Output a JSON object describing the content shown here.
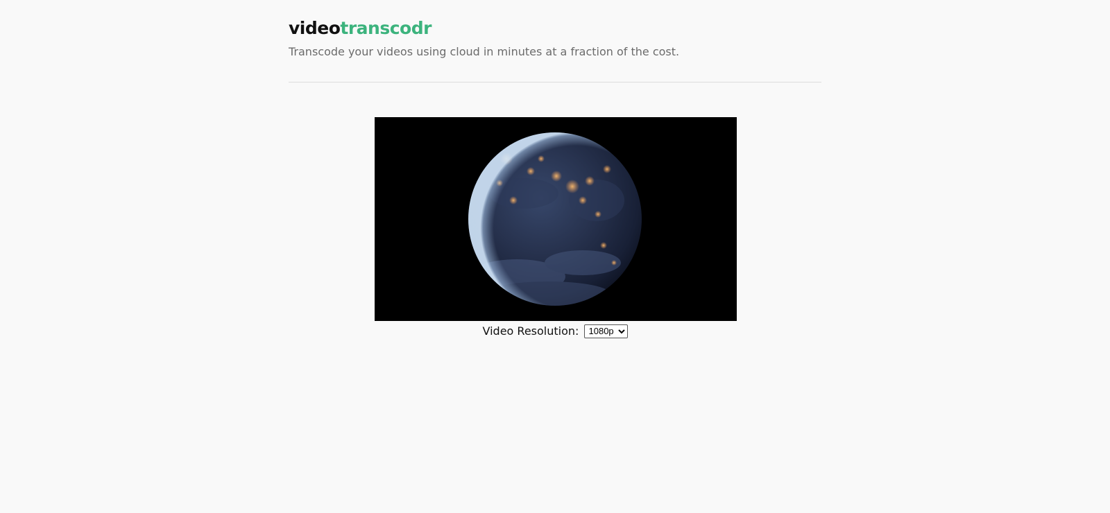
{
  "header": {
    "brand_part1": "video",
    "brand_part2": "transcodr",
    "tagline": "Transcode your videos using cloud in minutes at a fraction of the cost."
  },
  "player": {
    "content": "earth-at-night-video"
  },
  "resolution": {
    "label": "Video Resolution:",
    "selected": "1080p",
    "options": [
      "1080p"
    ]
  },
  "colors": {
    "accent": "#3cb37d",
    "background": "#f9f9f9",
    "video_bg": "#000000"
  }
}
